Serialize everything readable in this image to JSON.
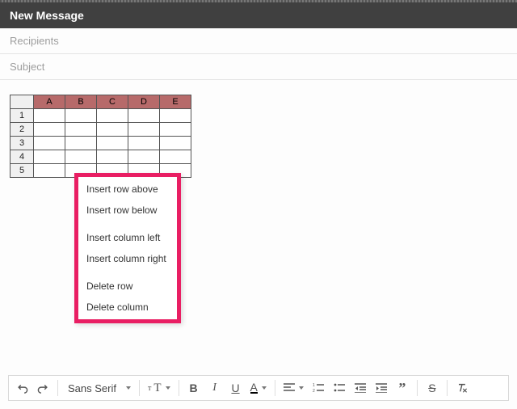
{
  "header": {
    "title": "New Message"
  },
  "fields": {
    "recipients_placeholder": "Recipients",
    "subject_placeholder": "Subject"
  },
  "table": {
    "columns": [
      "A",
      "B",
      "C",
      "D",
      "E"
    ],
    "rows": [
      "1",
      "2",
      "3",
      "4",
      "5"
    ]
  },
  "context_menu": {
    "items": [
      "Insert row above",
      "Insert row below",
      "Insert column left",
      "Insert column right",
      "Delete row",
      "Delete column"
    ]
  },
  "toolbar": {
    "font_label": "Sans Serif",
    "size_stub": "T",
    "bold": "B",
    "italic": "I",
    "underline": "U",
    "textcolor": "A",
    "quote": "”",
    "strike": "S"
  }
}
